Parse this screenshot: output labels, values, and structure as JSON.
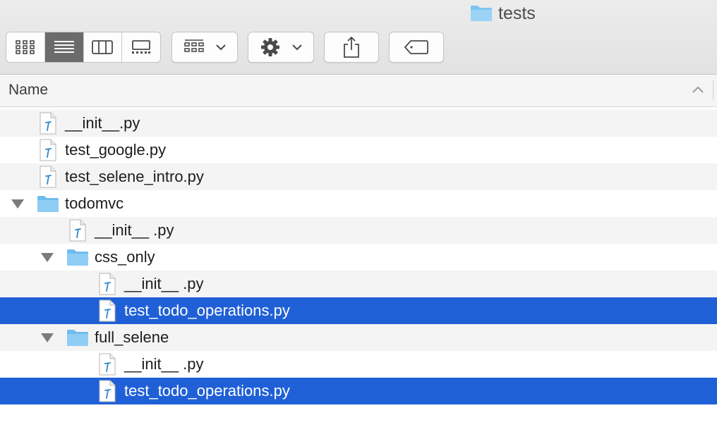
{
  "window": {
    "title": "tests",
    "title_icon": "folder-icon"
  },
  "toolbar": {
    "view_modes": [
      {
        "name": "icon-view",
        "icon": "icon-grid-icon",
        "active": false
      },
      {
        "name": "list-view",
        "icon": "list-lines-icon",
        "active": true
      },
      {
        "name": "column-view",
        "icon": "columns-icon",
        "active": false
      },
      {
        "name": "gallery-view",
        "icon": "gallery-icon",
        "active": false
      }
    ],
    "group_button": {
      "icon": "group-grid-icon",
      "dropdown": "chevron-down-icon"
    },
    "action_button": {
      "icon": "gear-icon",
      "dropdown": "chevron-down-icon"
    },
    "share_button": {
      "icon": "share-icon"
    },
    "tag_button": {
      "icon": "tag-icon"
    }
  },
  "list_header": {
    "name_label": "Name",
    "sort_icon": "chevron-up-icon"
  },
  "files": [
    {
      "name": "__init__.py",
      "kind": "python-file",
      "depth": 0,
      "expanded": null,
      "selected": false
    },
    {
      "name": "test_google.py",
      "kind": "python-file",
      "depth": 0,
      "expanded": null,
      "selected": false
    },
    {
      "name": "test_selene_intro.py",
      "kind": "python-file",
      "depth": 0,
      "expanded": null,
      "selected": false
    },
    {
      "name": "todomvc",
      "kind": "folder",
      "depth": 0,
      "expanded": true,
      "selected": false
    },
    {
      "name": "__init__ .py",
      "kind": "python-file",
      "depth": 1,
      "expanded": null,
      "selected": false
    },
    {
      "name": "css_only",
      "kind": "folder",
      "depth": 1,
      "expanded": true,
      "selected": false
    },
    {
      "name": "__init__ .py",
      "kind": "python-file",
      "depth": 2,
      "expanded": null,
      "selected": false
    },
    {
      "name": "test_todo_operations.py",
      "kind": "python-file",
      "depth": 2,
      "expanded": null,
      "selected": true
    },
    {
      "name": "full_selene",
      "kind": "folder",
      "depth": 1,
      "expanded": true,
      "selected": false
    },
    {
      "name": "__init__ .py",
      "kind": "python-file",
      "depth": 2,
      "expanded": null,
      "selected": false
    },
    {
      "name": "test_todo_operations.py",
      "kind": "python-file",
      "depth": 2,
      "expanded": null,
      "selected": true
    }
  ],
  "colors": {
    "selection": "#2060d7",
    "folder": "#7ec4f2",
    "alt_row": "#f4f4f4"
  }
}
